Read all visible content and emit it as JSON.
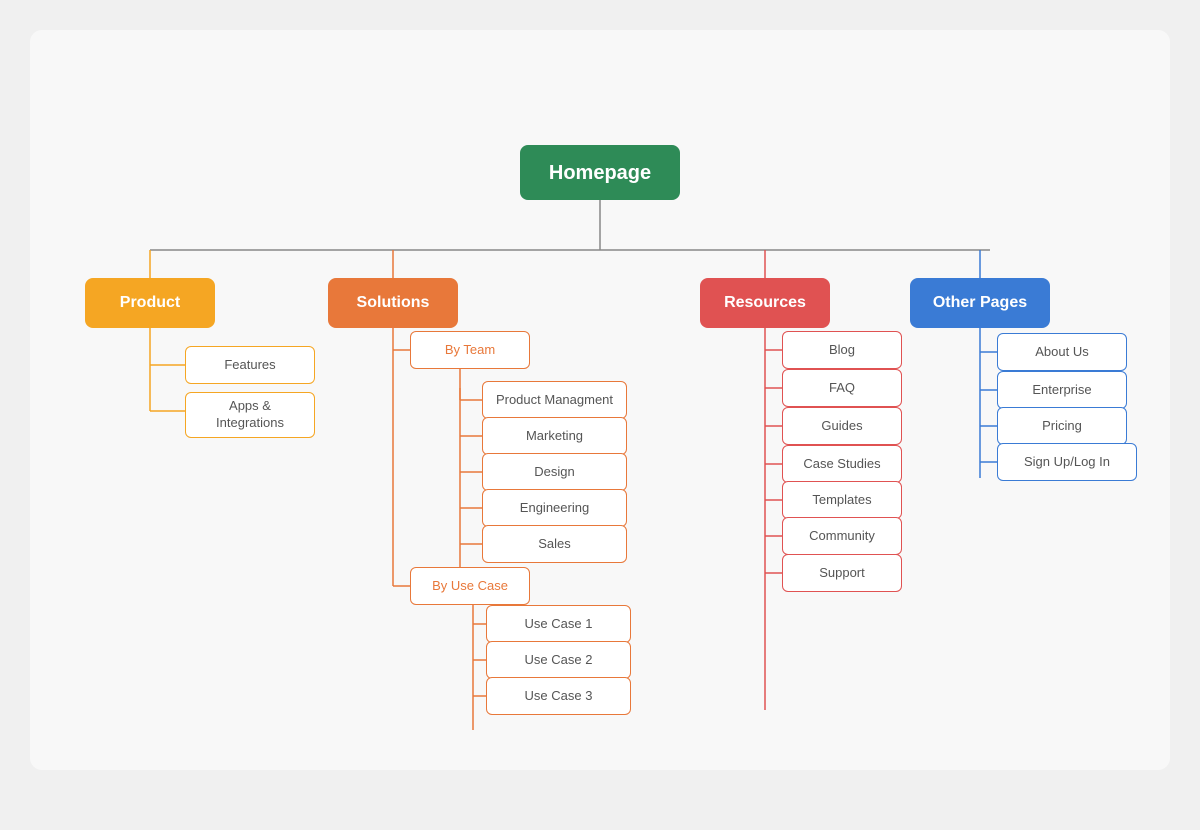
{
  "nodes": {
    "homepage": "Homepage",
    "product": "Product",
    "solutions": "Solutions",
    "resources": "Resources",
    "other_pages": "Other Pages",
    "features": "Features",
    "apps_integrations": "Apps & Integrations",
    "by_team": "By Team",
    "product_mgmt": "Product Managment",
    "marketing": "Marketing",
    "design": "Design",
    "engineering": "Engineering",
    "sales": "Sales",
    "by_use_case": "By Use Case",
    "use_case_1": "Use Case 1",
    "use_case_2": "Use Case 2",
    "use_case_3": "Use Case 3",
    "blog": "Blog",
    "faq": "FAQ",
    "guides": "Guides",
    "case_studies": "Case Studies",
    "templates": "Templates",
    "community": "Community",
    "support": "Support",
    "about_us": "About Us",
    "enterprise": "Enterprise",
    "pricing": "Pricing",
    "sign_up": "Sign Up/Log In"
  },
  "colors": {
    "homepage_bg": "#2e8b57",
    "product_bg": "#f5a623",
    "solutions_bg": "#e8783a",
    "resources_bg": "#e05252",
    "other_pages_bg": "#3a7bd5",
    "yellow_border": "#f5a623",
    "orange_border": "#e8783a",
    "red_border": "#e05252",
    "blue_border": "#3a7bd5",
    "blue_line": "#3a7bd5",
    "red_line": "#e05252",
    "orange_line": "#e8783a",
    "yellow_line": "#f5a623"
  }
}
